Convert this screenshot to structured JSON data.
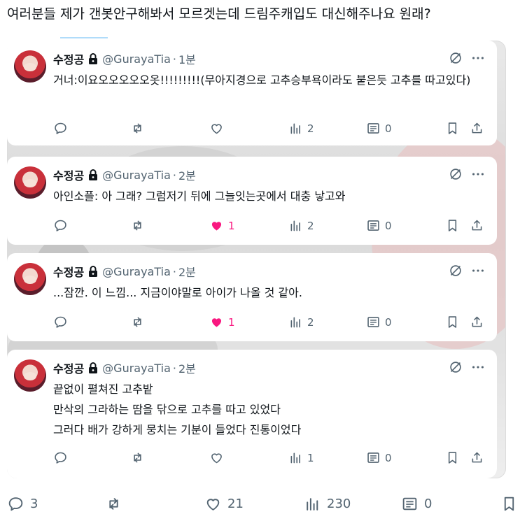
{
  "post": {
    "text": "여러분들 제가 갠봇안구해봐서 모르겟는데 드림주캐입도 대신해주나요 원래?"
  },
  "replies": [
    {
      "author": "수정공",
      "handle": "@GurayaTia",
      "time": "1분",
      "text_lines": [
        "거너:이요오오오오오옷!!!!!!!!!(무아지경으로 고추승부욕이라도 붙은듯 고추를 따고있다)"
      ],
      "stats": {
        "replies": "",
        "reposts": "",
        "likes": "",
        "views": "2",
        "notes": "0"
      },
      "liked": false
    },
    {
      "author": "수정공",
      "handle": "@GurayaTia",
      "time": "2분",
      "text_lines": [
        "아인소플: 아 그래? 그럼저기 뒤에 그늘잇는곳에서 대충 낳고와"
      ],
      "stats": {
        "replies": "",
        "reposts": "",
        "likes": "1",
        "views": "2",
        "notes": "0"
      },
      "liked": true
    },
    {
      "author": "수정공",
      "handle": "@GurayaTia",
      "time": "2분",
      "text_lines": [
        "...잠깐. 이 느낌... 지금이야말로 아이가 나올 것 같아."
      ],
      "stats": {
        "replies": "",
        "reposts": "",
        "likes": "1",
        "views": "2",
        "notes": "0"
      },
      "liked": true
    },
    {
      "author": "수정공",
      "handle": "@GurayaTia",
      "time": "2분",
      "text_lines": [
        "끝없이 펼쳐진 고추밭",
        "만삭의 그라하는 땀을 닦으로 고추를 따고 있었다",
        "그러다 배가 강하게 뭉치는 기분이 들었다 진통이었다"
      ],
      "stats": {
        "replies": "",
        "reposts": "",
        "likes": "",
        "views": "1",
        "notes": "0"
      },
      "liked": false
    }
  ],
  "bottom_stats": {
    "replies": "3",
    "reposts": "",
    "likes": "21",
    "views": "230",
    "notes": "0"
  },
  "colors": {
    "accent": "#1d9bf0",
    "like": "#f91880",
    "muted": "#536471",
    "text": "#0f1419"
  },
  "icons": [
    "reply-icon",
    "repost-icon",
    "like-icon",
    "views-icon",
    "notes-icon",
    "bookmark-icon",
    "share-icon",
    "grok-icon",
    "more-icon",
    "lock-icon"
  ]
}
